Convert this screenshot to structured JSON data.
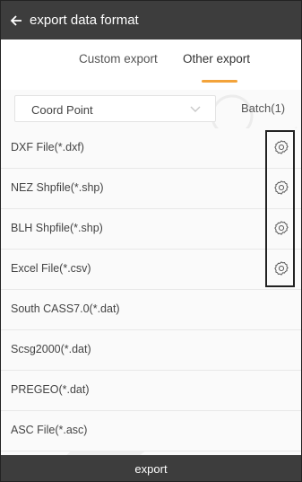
{
  "header": {
    "title": "export data format",
    "back_icon": "arrow-left-icon"
  },
  "tabs": [
    {
      "label": "Custom export",
      "active": false
    },
    {
      "label": "Other export",
      "active": true
    }
  ],
  "coord": {
    "selected": "Coord Point",
    "batch_label": "Batch(1)"
  },
  "formats": [
    {
      "label": "DXF File(*.dxf)",
      "has_settings": true
    },
    {
      "label": "NEZ Shpfile(*.shp)",
      "has_settings": true
    },
    {
      "label": "BLH Shpfile(*.shp)",
      "has_settings": true
    },
    {
      "label": "Excel File(*.csv)",
      "has_settings": true
    },
    {
      "label": "South CASS7.0(*.dat)",
      "has_settings": false
    },
    {
      "label": "Scsg2000(*.dat)",
      "has_settings": false
    },
    {
      "label": "PREGEO(*.dat)",
      "has_settings": false
    },
    {
      "label": "ASC File(*.asc)",
      "has_settings": false
    }
  ],
  "footer": {
    "export_label": "export"
  },
  "colors": {
    "bar": "#3d3d3d",
    "accent": "#f3a33a",
    "background": "#fafafa"
  }
}
